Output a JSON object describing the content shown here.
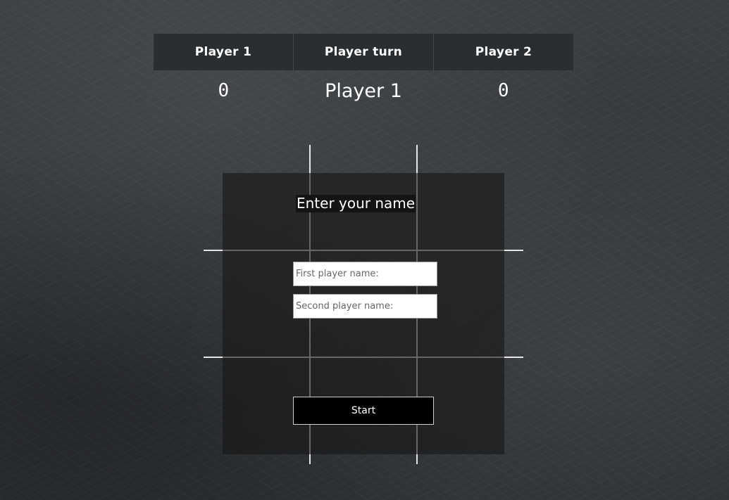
{
  "scoreboard": {
    "headers": {
      "player1": "Player 1",
      "turn": "Player turn",
      "player2": "Player 2"
    },
    "values": {
      "player1_score": "0",
      "current_turn": "Player 1",
      "player2_score": "0"
    }
  },
  "modal": {
    "title": "Enter your name",
    "first_player_placeholder": "First player name:",
    "second_player_placeholder": "Second player name:",
    "first_player_value": "",
    "second_player_value": "",
    "start_label": "Start"
  }
}
